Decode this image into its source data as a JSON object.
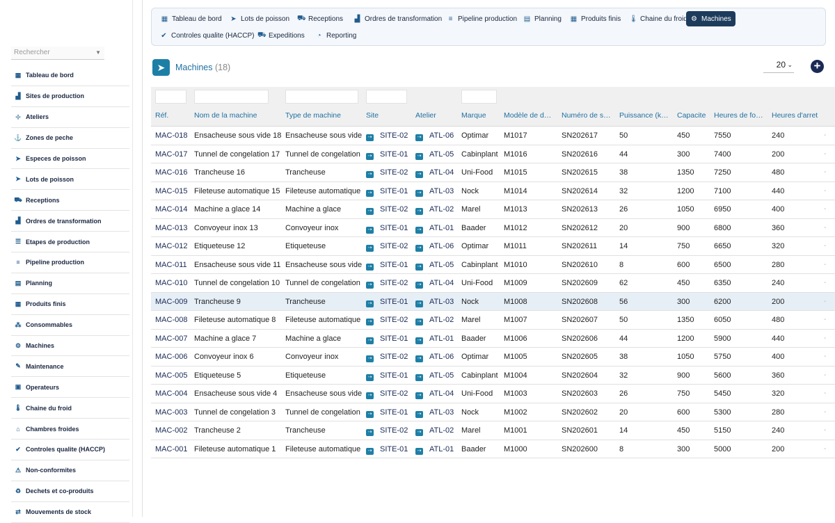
{
  "sidebar": {
    "search_placeholder": "Rechercher",
    "items": [
      {
        "label": "Tableau de bord",
        "icon": "dashboard-icon",
        "glyph": "▦"
      },
      {
        "label": "Sites de production",
        "icon": "factory-icon",
        "glyph": "▟"
      },
      {
        "label": "Ateliers",
        "icon": "sitemap-icon",
        "glyph": "⊹"
      },
      {
        "label": "Zones de peche",
        "icon": "anchor-icon",
        "glyph": "⚓"
      },
      {
        "label": "Especes de poisson",
        "icon": "fish-icon",
        "glyph": "➤"
      },
      {
        "label": "Lots de poisson",
        "icon": "fish-icon",
        "glyph": "➤"
      },
      {
        "label": "Receptions",
        "icon": "truck-loading-icon",
        "glyph": "⛟"
      },
      {
        "label": "Ordres de transformation",
        "icon": "industry-icon",
        "glyph": "▟"
      },
      {
        "label": "Etapes de production",
        "icon": "list-icon",
        "glyph": "☰"
      },
      {
        "label": "Pipeline production",
        "icon": "stream-icon",
        "glyph": "≡"
      },
      {
        "label": "Planning",
        "icon": "calendar-icon",
        "glyph": "▤"
      },
      {
        "label": "Produits finis",
        "icon": "boxes-icon",
        "glyph": "▦"
      },
      {
        "label": "Consommables",
        "icon": "cubes-icon",
        "glyph": "⁂"
      },
      {
        "label": "Machines",
        "icon": "cogs-icon",
        "glyph": "⚙"
      },
      {
        "label": "Maintenance",
        "icon": "wrench-icon",
        "glyph": "✎"
      },
      {
        "label": "Operateurs",
        "icon": "id-card-icon",
        "glyph": "▣"
      },
      {
        "label": "Chaine du froid",
        "icon": "thermometer-icon",
        "glyph": "🌡"
      },
      {
        "label": "Chambres froides",
        "icon": "warehouse-icon",
        "glyph": "⌂"
      },
      {
        "label": "Controles qualite (HACCP)",
        "icon": "clipboard-check-icon",
        "glyph": "✔"
      },
      {
        "label": "Non-conformites",
        "icon": "warning-icon",
        "glyph": "⚠"
      },
      {
        "label": "Dechets et co-produits",
        "icon": "recycle-icon",
        "glyph": "♻"
      },
      {
        "label": "Mouvements de stock",
        "icon": "exchange-icon",
        "glyph": "⇄"
      }
    ]
  },
  "topnav": {
    "items": [
      {
        "label": "Tableau de bord",
        "icon": "dashboard-icon",
        "glyph": "▦",
        "active": false
      },
      {
        "label": "Lots de poisson",
        "icon": "fish-icon",
        "glyph": "➤",
        "active": false
      },
      {
        "label": "Receptions",
        "icon": "truck-loading-icon",
        "glyph": "⛟",
        "active": false
      },
      {
        "label": "Ordres de transformation",
        "icon": "industry-icon",
        "glyph": "▟",
        "active": false
      },
      {
        "label": "Pipeline production",
        "icon": "stream-icon",
        "glyph": "≡",
        "active": false
      },
      {
        "label": "Planning",
        "icon": "calendar-icon",
        "glyph": "▤",
        "active": false
      },
      {
        "label": "Produits finis",
        "icon": "boxes-icon",
        "glyph": "▦",
        "active": false
      },
      {
        "label": "Chaine du froid",
        "icon": "thermometer-icon",
        "glyph": "🌡",
        "active": false
      },
      {
        "label": "Machines",
        "icon": "cogs-icon",
        "glyph": "⚙",
        "active": true
      },
      {
        "label": "Controles qualite (HACCP)",
        "icon": "clipboard-check-icon",
        "glyph": "✔",
        "active": false
      },
      {
        "label": "Expeditions",
        "icon": "truck-icon",
        "glyph": "⛟",
        "active": false
      },
      {
        "label": "Reporting",
        "icon": "chart-pie-icon",
        "glyph": "◔",
        "active": false
      }
    ]
  },
  "header": {
    "title": "Machines",
    "count": "(18)",
    "page_size": "20",
    "logo_icon": "fish-icon",
    "add_icon": "plus-circle-icon",
    "add_glyph": "+"
  },
  "table": {
    "columns": [
      "Réf.",
      "Nom de la machine",
      "Type de machine",
      "Site",
      "Atelier",
      "Marque",
      "Modèle de d…",
      "Numéro de s…",
      "Puissance (k…",
      "Capacite",
      "Heures de fo…",
      "Heures d'arret"
    ],
    "rows": [
      [
        "MAC-018",
        "Ensacheuse sous vide 18",
        "Ensacheuse sous vide",
        "SITE-02",
        "ATL-06",
        "Optimar",
        "M1017",
        "SN202617",
        "50",
        "450",
        "7550",
        "240"
      ],
      [
        "MAC-017",
        "Tunnel de congelation 17",
        "Tunnel de congelation",
        "SITE-01",
        "ATL-05",
        "Cabinplant",
        "M1016",
        "SN202616",
        "44",
        "300",
        "7400",
        "200"
      ],
      [
        "MAC-016",
        "Trancheuse 16",
        "Trancheuse",
        "SITE-02",
        "ATL-04",
        "Uni-Food",
        "M1015",
        "SN202615",
        "38",
        "1350",
        "7250",
        "480"
      ],
      [
        "MAC-015",
        "Fileteuse automatique 15",
        "Fileteuse automatique",
        "SITE-01",
        "ATL-03",
        "Nock",
        "M1014",
        "SN202614",
        "32",
        "1200",
        "7100",
        "440"
      ],
      [
        "MAC-014",
        "Machine a glace 14",
        "Machine a glace",
        "SITE-02",
        "ATL-02",
        "Marel",
        "M1013",
        "SN202613",
        "26",
        "1050",
        "6950",
        "400"
      ],
      [
        "MAC-013",
        "Convoyeur inox 13",
        "Convoyeur inox",
        "SITE-01",
        "ATL-01",
        "Baader",
        "M1012",
        "SN202612",
        "20",
        "900",
        "6800",
        "360"
      ],
      [
        "MAC-012",
        "Etiqueteuse 12",
        "Etiqueteuse",
        "SITE-02",
        "ATL-06",
        "Optimar",
        "M1011",
        "SN202611",
        "14",
        "750",
        "6650",
        "320"
      ],
      [
        "MAC-011",
        "Ensacheuse sous vide 11",
        "Ensacheuse sous vide",
        "SITE-01",
        "ATL-05",
        "Cabinplant",
        "M1010",
        "SN202610",
        "8",
        "600",
        "6500",
        "280"
      ],
      [
        "MAC-010",
        "Tunnel de congelation 10",
        "Tunnel de congelation",
        "SITE-02",
        "ATL-04",
        "Uni-Food",
        "M1009",
        "SN202609",
        "62",
        "450",
        "6350",
        "240"
      ],
      [
        "MAC-009",
        "Trancheuse 9",
        "Trancheuse",
        "SITE-01",
        "ATL-03",
        "Nock",
        "M1008",
        "SN202608",
        "56",
        "300",
        "6200",
        "200"
      ],
      [
        "MAC-008",
        "Fileteuse automatique 8",
        "Fileteuse automatique",
        "SITE-02",
        "ATL-02",
        "Marel",
        "M1007",
        "SN202607",
        "50",
        "1350",
        "6050",
        "480"
      ],
      [
        "MAC-007",
        "Machine a glace 7",
        "Machine a glace",
        "SITE-01",
        "ATL-01",
        "Baader",
        "M1006",
        "SN202606",
        "44",
        "1200",
        "5900",
        "440"
      ],
      [
        "MAC-006",
        "Convoyeur inox 6",
        "Convoyeur inox",
        "SITE-02",
        "ATL-06",
        "Optimar",
        "M1005",
        "SN202605",
        "38",
        "1050",
        "5750",
        "400"
      ],
      [
        "MAC-005",
        "Etiqueteuse 5",
        "Etiqueteuse",
        "SITE-01",
        "ATL-05",
        "Cabinplant",
        "M1004",
        "SN202604",
        "32",
        "900",
        "5600",
        "360"
      ],
      [
        "MAC-004",
        "Ensacheuse sous vide 4",
        "Ensacheuse sous vide",
        "SITE-02",
        "ATL-04",
        "Uni-Food",
        "M1003",
        "SN202603",
        "26",
        "750",
        "5450",
        "320"
      ],
      [
        "MAC-003",
        "Tunnel de congelation 3",
        "Tunnel de congelation",
        "SITE-01",
        "ATL-03",
        "Nock",
        "M1002",
        "SN202602",
        "20",
        "600",
        "5300",
        "280"
      ],
      [
        "MAC-002",
        "Trancheuse 2",
        "Trancheuse",
        "SITE-02",
        "ATL-02",
        "Marel",
        "M1001",
        "SN202601",
        "14",
        "450",
        "5150",
        "240"
      ],
      [
        "MAC-001",
        "Fileteuse automatique 1",
        "Fileteuse automatique",
        "SITE-01",
        "ATL-01",
        "Baader",
        "M1000",
        "SN202600",
        "8",
        "300",
        "5000",
        "200"
      ]
    ],
    "highlighted_row": 9,
    "link_icon": "link-badge-icon",
    "truncated_marker": "-"
  },
  "colors": {
    "accent": "#1f6fa0",
    "active_nav": "#1d3c5c",
    "link": "#1a2a55",
    "highlight_row": "#e6eef6"
  }
}
